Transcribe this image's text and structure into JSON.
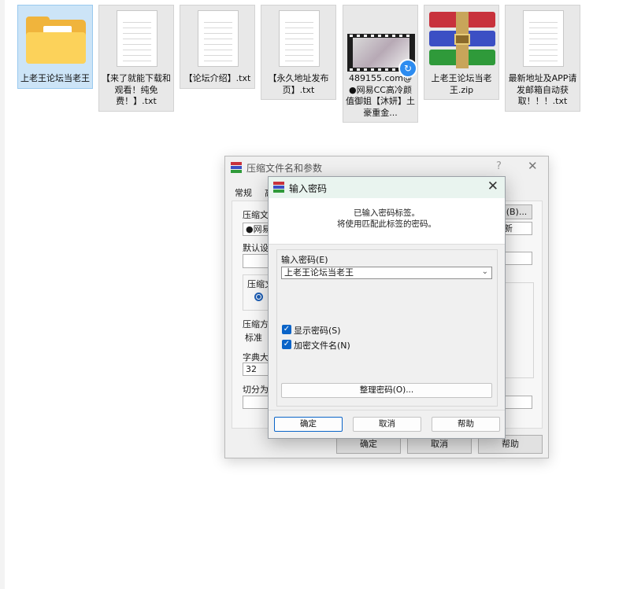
{
  "desktop": {
    "files": [
      {
        "name": "上老王论坛当老王",
        "icon": "folder-icon",
        "selected": true
      },
      {
        "name": "【来了就能下载和观看！纯免费！】.txt",
        "icon": "text-document-icon"
      },
      {
        "name": "【论坛介绍】.txt",
        "icon": "text-document-icon"
      },
      {
        "name": "【永久地址发布页】.txt",
        "icon": "text-document-icon"
      },
      {
        "name": "489155.com@●网易CC高冷颜值御姐【沐妍】土豪重金...",
        "icon": "video-thumbnail-icon"
      },
      {
        "name": "上老王论坛当老王.zip",
        "icon": "winrar-archive-icon"
      },
      {
        "name": "最新地址及APP请发邮箱自动获取！！！.txt",
        "icon": "text-document-icon"
      }
    ]
  },
  "archive_dialog": {
    "title": "压缩文件名和参数",
    "help_glyph": "?",
    "close_glyph": "✕",
    "tab_general": "常规",
    "tab_other_fragment": "高",
    "archive_name_label": "压缩文",
    "archive_name_value": "●网易",
    "browse_button": "(B)...",
    "update_mode_fragment": "新",
    "default_profile_label": "默认设",
    "format_group_label": "压缩文",
    "method_label": "压缩方",
    "method_value": "标准",
    "dict_label": "字典大",
    "dict_value": "32",
    "split_label": "切分为",
    "ok_button": "确定",
    "cancel_button": "取消",
    "help_button": "帮助"
  },
  "password_dialog": {
    "title": "输入密码",
    "close_glyph": "✕",
    "info_line1": "已输入密码标签。",
    "info_line2": "将使用匹配此标签的密码。",
    "password_label": "输入密码(E)",
    "password_value": "上老王论坛当老王",
    "show_password_label": "显示密码(S)",
    "show_password_checked": true,
    "encrypt_names_label": "加密文件名(N)",
    "encrypt_names_checked": true,
    "organize_button": "整理密码(O)...",
    "ok_button": "确定",
    "cancel_button": "取消",
    "help_button": "帮助",
    "check_glyph": "✓",
    "chevron_glyph": "⌄"
  },
  "colors": {
    "selection": "#cce4f7",
    "accent": "#0a64c8",
    "titlebar_tint": "#e9f4ef"
  }
}
